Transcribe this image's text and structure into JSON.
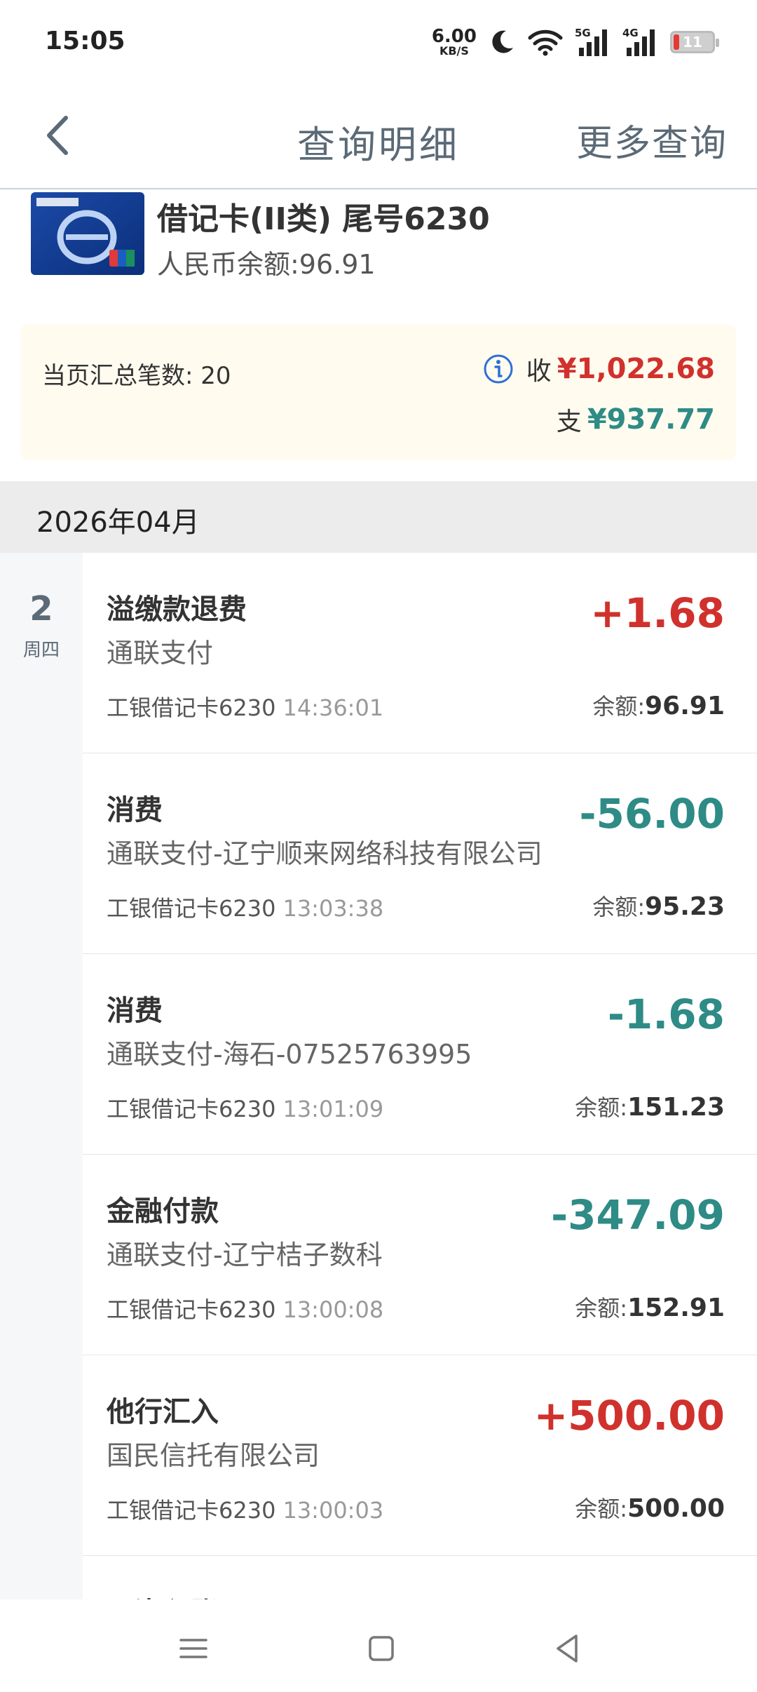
{
  "status_bar": {
    "time": "15:05",
    "net_speed_value": "6.00",
    "net_speed_unit": "KB/S",
    "signal_1": "5G",
    "signal_2": "4G",
    "battery": "11",
    "battery_color": "#e53935",
    "icons": [
      "moon-icon",
      "wifi-icon",
      "signal-5g-icon",
      "signal-4g-icon",
      "battery-icon"
    ]
  },
  "nav": {
    "title": "查询明细",
    "more_label": "更多查询",
    "back_icon": "chevron-left-icon"
  },
  "account": {
    "name": "借记卡(II类) 尾号6230",
    "balance": "人民币余额:96.91"
  },
  "summary": {
    "count": "当页汇总笔数: 20",
    "income_label": "收",
    "income_amount": "¥1,022.68",
    "expense_label": "支",
    "expense_amount": "¥937.77",
    "income_color": "#d0312d",
    "expense_color": "#2e8b86"
  },
  "month": "2026年04月",
  "date": {
    "day": "2",
    "weekday": "周四"
  },
  "transactions": [
    {
      "title": "溢缴款退费",
      "sub": "通联支付",
      "card": "工银借记卡6230",
      "time": "14:36:01",
      "amount": "+1.68",
      "balance_label": "余额:",
      "balance": "96.91"
    },
    {
      "title": "消费",
      "sub": "通联支付-辽宁顺来网络科技有限公司",
      "card": "工银借记卡6230",
      "time": "13:03:38",
      "amount": "-56.00",
      "balance_label": "余额:",
      "balance": "95.23"
    },
    {
      "title": "消费",
      "sub": "通联支付-海石-07525763995",
      "card": "工银借记卡6230",
      "time": "13:01:09",
      "amount": "-1.68",
      "balance_label": "余额:",
      "balance": "151.23"
    },
    {
      "title": "金融付款",
      "sub": "通联支付-辽宁桔子数科",
      "card": "工银借记卡6230",
      "time": "13:00:08",
      "amount": "-347.09",
      "balance_label": "余额:",
      "balance": "152.91"
    },
    {
      "title": "他行汇入",
      "sub": "国民信托有限公司",
      "card": "工银借记卡6230",
      "time": "13:00:03",
      "amount": "+500.00",
      "balance_label": "余额:",
      "balance": "500.00"
    },
    {
      "title": "工资入账",
      "sub": "",
      "card": "",
      "time": "",
      "amount": "",
      "balance_label": "",
      "balance": ""
    }
  ],
  "bottom_nav": [
    "menu-icon",
    "home-icon",
    "back-triangle-icon"
  ]
}
